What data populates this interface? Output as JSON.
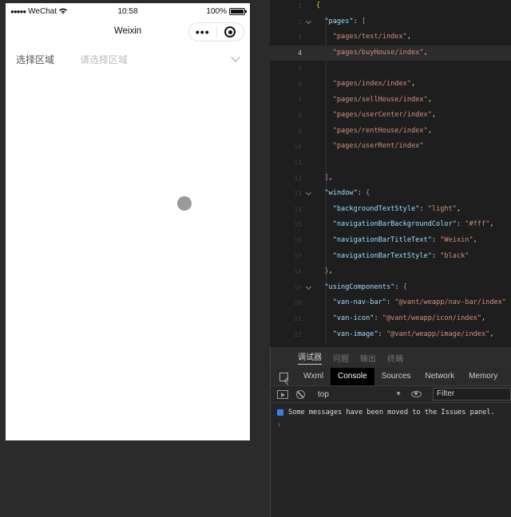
{
  "statusbar": {
    "carrier": "WeChat",
    "time": "10:58",
    "battery": "100%"
  },
  "navbar": {
    "title": "Weixin"
  },
  "form": {
    "label": "选择区域",
    "placeholder": "请选择区域"
  },
  "editor": {
    "lines": [
      {
        "num": "1",
        "html": "<span class='b1'>{</span>"
      },
      {
        "num": "2",
        "html": "  <span class='k'>\"pages\"</span><span class='p'>: </span><span class='b2'>[</span>"
      },
      {
        "num": "3",
        "html": "    <span class='s'>\"pages/test/index\"</span><span class='p'>,</span>"
      },
      {
        "num": "4",
        "html": "    <span class='s'>\"pages/buyHouse/index\"</span><span class='p'>,</span>"
      },
      {
        "num": "5",
        "html": ""
      },
      {
        "num": "6",
        "html": "    <span class='s'>\"pages/index/index\"</span><span class='p'>,</span>"
      },
      {
        "num": "7",
        "html": "    <span class='s'>\"pages/sellHouse/index\"</span><span class='p'>,</span>"
      },
      {
        "num": "8",
        "html": "    <span class='s'>\"pages/userCenter/index\"</span><span class='p'>,</span>"
      },
      {
        "num": "9",
        "html": "    <span class='s'>\"pages/rentHouse/index\"</span><span class='p'>,</span>"
      },
      {
        "num": "10",
        "html": "    <span class='s'>\"pages/userRent/index\"</span>"
      },
      {
        "num": "11",
        "html": ""
      },
      {
        "num": "12",
        "html": "  <span class='b2'>]</span><span class='p'>,</span>"
      },
      {
        "num": "13",
        "html": "  <span class='k'>\"window\"</span><span class='p'>: </span><span class='b2'>{</span>"
      },
      {
        "num": "14",
        "html": "    <span class='k'>\"backgroundTextStyle\"</span><span class='p'>: </span><span class='s'>\"light\"</span><span class='p'>,</span>"
      },
      {
        "num": "15",
        "html": "    <span class='k'>\"navigationBarBackgroundColor\"</span><span class='p'>: </span><span class='s'>\"#fff\"</span><span class='p'>,</span>"
      },
      {
        "num": "16",
        "html": "    <span class='k'>\"navigationBarTitleText\"</span><span class='p'>: </span><span class='s'>\"Weixin\"</span><span class='p'>,</span>"
      },
      {
        "num": "17",
        "html": "    <span class='k'>\"navigationBarTextStyle\"</span><span class='p'>: </span><span class='s'>\"black\"</span>"
      },
      {
        "num": "18",
        "html": "  <span class='b2'>}</span><span class='p'>,</span>"
      },
      {
        "num": "19",
        "html": "  <span class='k'>\"usingComponents\"</span><span class='p'>: </span><span class='b2'>{</span>"
      },
      {
        "num": "20",
        "html": "    <span class='k'>\"van-nav-bar\"</span><span class='p'>: </span><span class='s'>\"@vant/weapp/nav-bar/index\"</span>"
      },
      {
        "num": "21",
        "html": "    <span class='k'>\"van-icon\"</span><span class='p'>: </span><span class='s'>\"@vant/weapp/icon/index\"</span><span class='p'>,</span>"
      },
      {
        "num": "22",
        "html": "    <span class='k'>\"van-image\"</span><span class='p'>: </span><span class='s'>\"@vant/weapp/image/index\"</span><span class='p'>,</span>"
      }
    ],
    "current_line": "4",
    "fold_lines": [
      "2",
      "13",
      "19"
    ]
  },
  "panel": {
    "tabs": [
      "调试器",
      "问题",
      "输出",
      "终端"
    ],
    "devtools_tabs": [
      "Wxml",
      "Console",
      "Sources",
      "Network",
      "Memory"
    ],
    "active_devtools_tab": "Console",
    "context": "top",
    "filter_placeholder": "Filter",
    "message": "Some messages have been moved to the Issues panel.",
    "prompt": "›"
  }
}
